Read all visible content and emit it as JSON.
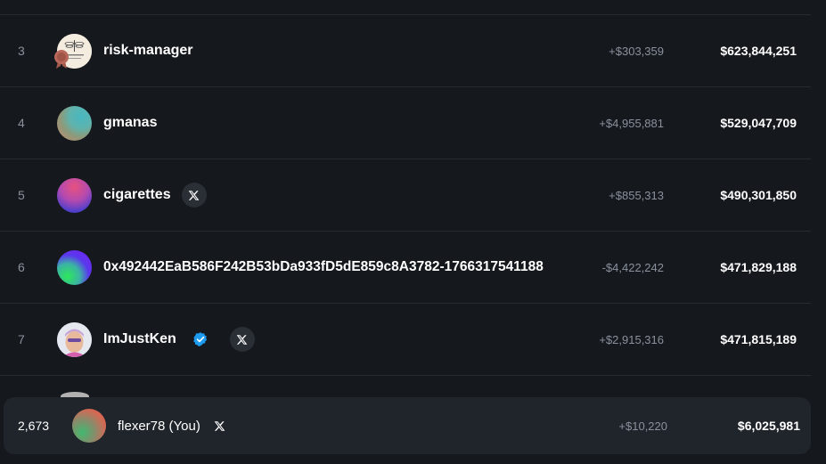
{
  "leaderboard": {
    "rows": [
      {
        "rank": "3",
        "name": "risk-manager",
        "change": "+$303,359",
        "total": "$623,844,251",
        "avatar_icon": "dragonfly-logo-avatar",
        "has_x": false,
        "verified": false
      },
      {
        "rank": "4",
        "name": "gmanas",
        "change": "+$4,955,881",
        "total": "$529,047,709",
        "avatar_icon": "gradient-avatar",
        "has_x": false,
        "verified": false
      },
      {
        "rank": "5",
        "name": "cigarettes",
        "change": "+$855,313",
        "total": "$490,301,850",
        "avatar_icon": "gradient-avatar",
        "has_x": true,
        "verified": false
      },
      {
        "rank": "6",
        "name": "0x492442EaB586F242B53bDa933fD5dE859c8A3782-1766317541188",
        "change": "-$4,422,242",
        "total": "$471,829,188",
        "avatar_icon": "gradient-avatar",
        "has_x": false,
        "verified": false
      },
      {
        "rank": "7",
        "name": "ImJustKen",
        "change": "+$2,915,316",
        "total": "$471,815,189",
        "avatar_icon": "photo-avatar",
        "has_x": true,
        "verified": true
      }
    ],
    "current_user": {
      "rank": "2,673",
      "name": "flexer78 (You)",
      "change": "+$10,220",
      "total": "$6,025,981",
      "avatar_icon": "gradient-avatar",
      "has_x": true
    }
  },
  "colors": {
    "background": "#15181d",
    "row_divider": "#262a31",
    "muted_text": "#8a919c",
    "current_user_bg": "#20252b",
    "verified_blue": "#1d9bf0"
  },
  "icons": {
    "x_logo": "x-logo-icon",
    "verified": "verified-badge-icon"
  }
}
